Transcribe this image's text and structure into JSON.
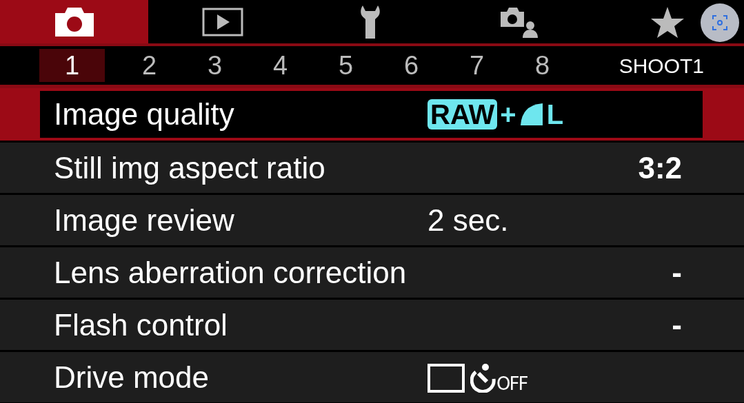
{
  "tabs": [
    {
      "kind": "camera",
      "selected": true
    },
    {
      "kind": "play",
      "selected": false
    },
    {
      "kind": "wrench",
      "selected": false
    },
    {
      "kind": "camera-person",
      "selected": false
    },
    {
      "kind": "star",
      "selected": false
    }
  ],
  "pages": [
    {
      "label": "1",
      "selected": true
    },
    {
      "label": "2",
      "selected": false
    },
    {
      "label": "3",
      "selected": false
    },
    {
      "label": "4",
      "selected": false
    },
    {
      "label": "5",
      "selected": false
    },
    {
      "label": "6",
      "selected": false
    },
    {
      "label": "7",
      "selected": false
    },
    {
      "label": "8",
      "selected": false
    }
  ],
  "page_title": "SHOOT1",
  "menu": [
    {
      "label": "Image quality",
      "selected": true,
      "kind": "quality",
      "badge": "RAW",
      "plus": "+",
      "size": "L"
    },
    {
      "label": "Still img aspect ratio",
      "selected": false,
      "kind": "right",
      "value": "3:2"
    },
    {
      "label": "Image review",
      "selected": false,
      "kind": "mid",
      "value": "2 sec."
    },
    {
      "label": "Lens aberration correction",
      "selected": false,
      "kind": "right",
      "value": "-"
    },
    {
      "label": "Flash control",
      "selected": false,
      "kind": "right",
      "value": "-"
    },
    {
      "label": "Drive mode",
      "selected": false,
      "kind": "drive",
      "value": "OFF"
    }
  ]
}
